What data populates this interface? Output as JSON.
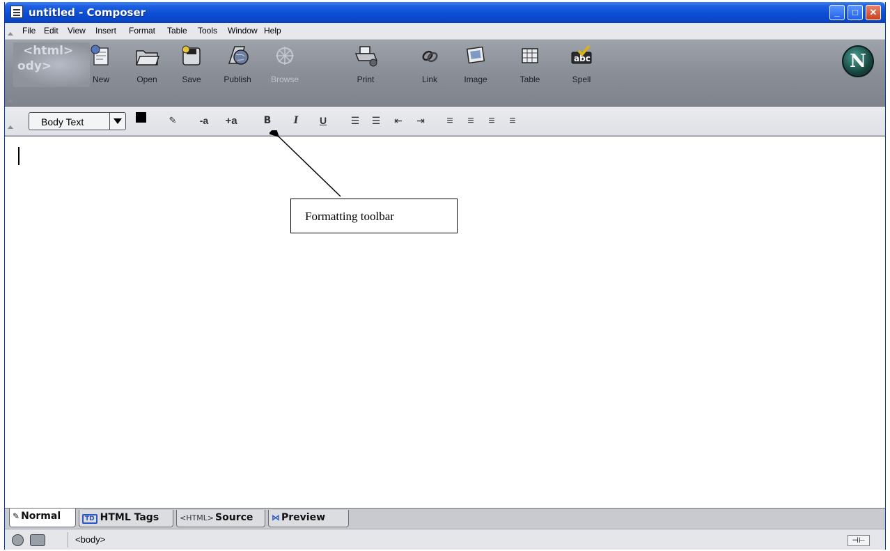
{
  "window": {
    "title": "untitled - Composer",
    "controls": [
      "minimize",
      "maximize",
      "close"
    ]
  },
  "menubar": {
    "items": [
      "File",
      "Edit",
      "View",
      "Insert",
      "Format",
      "Table",
      "Tools",
      "Window",
      "Help"
    ]
  },
  "composition_toolbar": {
    "buttons": [
      {
        "label": "New",
        "icon": "new-page-icon",
        "enabled": true
      },
      {
        "label": "Open",
        "icon": "folder-icon",
        "enabled": true
      },
      {
        "label": "Save",
        "icon": "save-disk-icon",
        "enabled": true
      },
      {
        "label": "Publish",
        "icon": "globe-icon",
        "enabled": true
      },
      {
        "label": "Browse",
        "icon": "browse-icon",
        "enabled": false
      },
      {
        "label": "Print",
        "icon": "printer-icon",
        "enabled": true
      },
      {
        "label": "Link",
        "icon": "chain-link-icon",
        "enabled": true
      },
      {
        "label": "Image",
        "icon": "picture-icon",
        "enabled": true
      },
      {
        "label": "Table",
        "icon": "table-icon",
        "enabled": true
      },
      {
        "label": "Spell",
        "icon": "spellcheck-icon",
        "enabled": true
      }
    ],
    "logo": "N"
  },
  "formatting_toolbar": {
    "paragraph_style": "Body Text",
    "text_color": "#000000",
    "background_color": "#ffffff",
    "buttons": [
      {
        "glyph": "✎",
        "icon": "highlight-pencil-icon"
      },
      {
        "glyph": "-a",
        "icon": "smaller-font-icon"
      },
      {
        "glyph": "+a",
        "icon": "larger-font-icon"
      },
      {
        "glyph": "B",
        "icon": "bold-icon"
      },
      {
        "glyph": "I",
        "icon": "italic-icon"
      },
      {
        "glyph": "U",
        "icon": "underline-icon"
      },
      {
        "glyph": "☰",
        "icon": "bullet-list-icon"
      },
      {
        "glyph": "☰",
        "icon": "numbered-list-icon"
      },
      {
        "glyph": "⇤",
        "icon": "outdent-icon"
      },
      {
        "glyph": "⇥",
        "icon": "indent-icon"
      },
      {
        "glyph": "≡",
        "icon": "align-left-icon"
      },
      {
        "glyph": "≡",
        "icon": "align-center-icon"
      },
      {
        "glyph": "≡",
        "icon": "align-right-icon"
      },
      {
        "glyph": "≡",
        "icon": "justify-icon"
      }
    ]
  },
  "annotation": {
    "label": "Formatting toolbar"
  },
  "tabs": [
    {
      "label": "Normal",
      "active": true
    },
    {
      "label": "HTML Tags",
      "active": false
    },
    {
      "label": "Source",
      "active": false
    },
    {
      "label": "Preview",
      "active": false
    }
  ],
  "tab_icons": {
    "tags": "TD",
    "source": "<HTML>"
  },
  "statusbar": {
    "path": "<body>"
  }
}
